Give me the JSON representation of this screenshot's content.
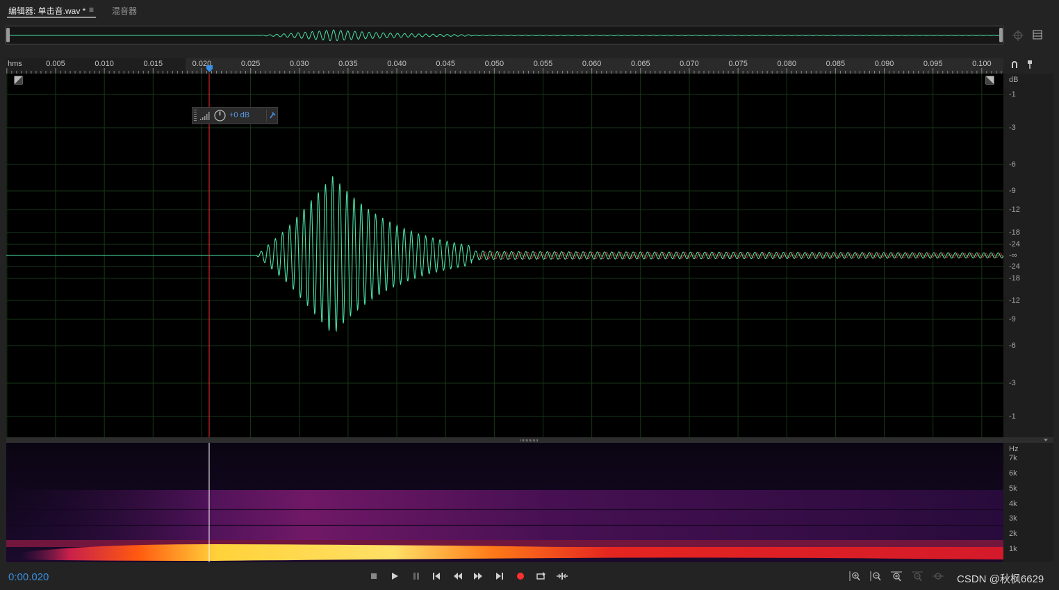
{
  "tabs": {
    "editor_label": "编辑器: 单击音.wav *",
    "editor_menu": "≡",
    "mixer_label": "混音器"
  },
  "ruler": {
    "unit": "hms",
    "ticks": [
      "0.005",
      "0.010",
      "0.015",
      "0.020",
      "0.025",
      "0.030",
      "0.035",
      "0.040",
      "0.045",
      "0.050",
      "0.055",
      "0.060",
      "0.065",
      "0.070",
      "0.075",
      "0.080",
      "0.085",
      "0.090",
      "0.095",
      "0.100"
    ]
  },
  "amplitude_scale": {
    "unit": "dB",
    "labels": [
      "-1",
      "-3",
      "-6",
      "-9",
      "-12",
      "-18",
      "-24",
      "-∞",
      "-24",
      "-18",
      "-12",
      "-9",
      "-6",
      "-3",
      "-1"
    ]
  },
  "hud": {
    "gain": "+0 dB"
  },
  "frequency_scale": {
    "unit": "Hz",
    "labels": [
      "7k",
      "6k",
      "5k",
      "4k",
      "3k",
      "2k",
      "1k"
    ]
  },
  "transport": {
    "time": "0:00.020",
    "buttons": [
      "stop",
      "play",
      "pause",
      "skip-to-start",
      "rewind",
      "fast-forward",
      "skip-to-end",
      "record",
      "loop",
      "skip-selection"
    ]
  },
  "colors": {
    "waveform": "#4be3a6",
    "playhead": "#ff2b2b",
    "time_display": "#3b8ede",
    "record": "#ff3030"
  },
  "watermark": "CSDN @秋枫6629"
}
